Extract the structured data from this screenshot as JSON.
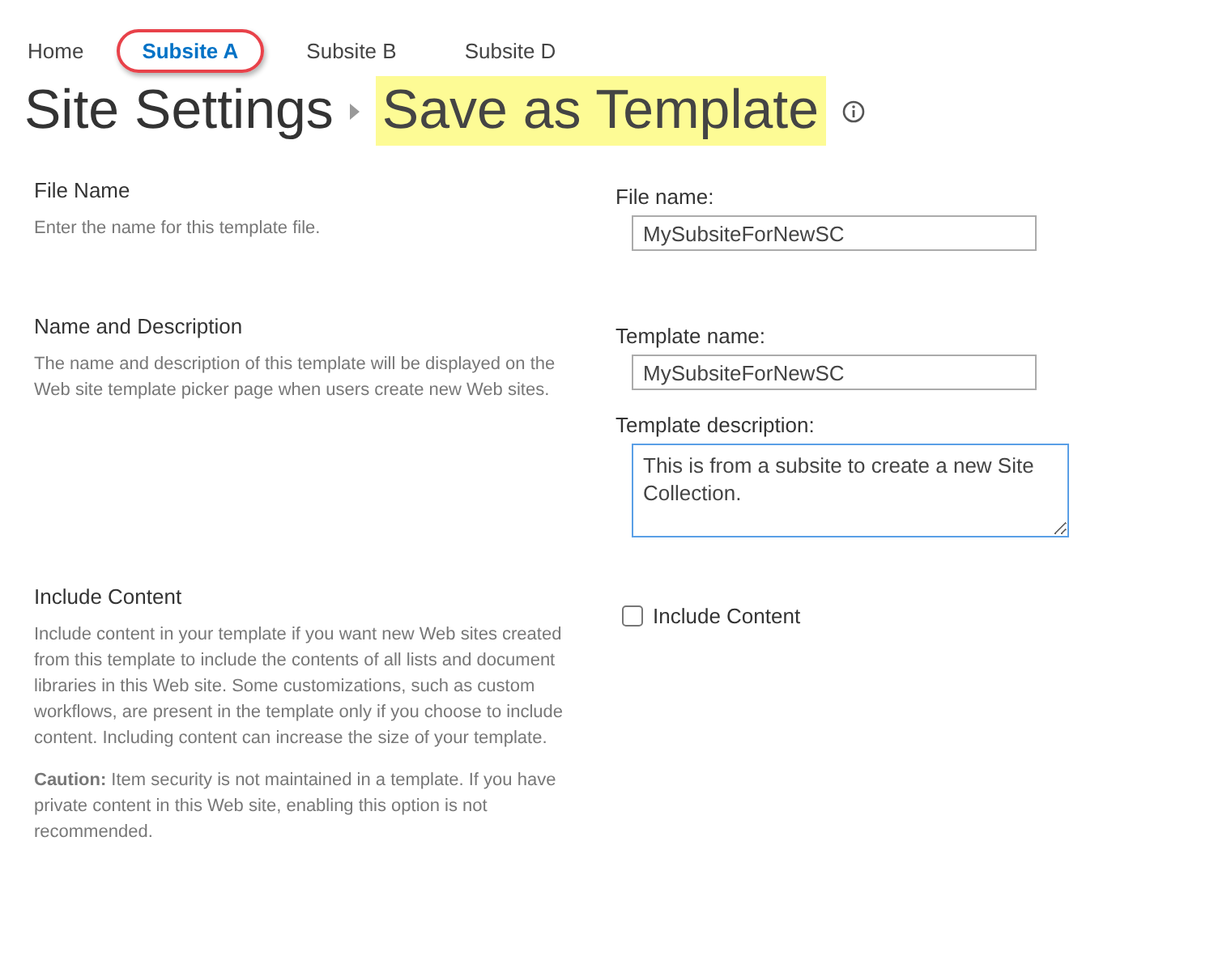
{
  "breadcrumb_nav": [
    {
      "label": "Home",
      "selected": false,
      "circled": false
    },
    {
      "label": "Subsite A",
      "selected": true,
      "circled": true
    },
    {
      "label": "Subsite B",
      "selected": false,
      "circled": false
    },
    {
      "label": "Subsite D",
      "selected": false,
      "circled": false
    }
  ],
  "page_title": {
    "parent": "Site Settings",
    "current": "Save as Template",
    "highlighted": true
  },
  "sections": [
    {
      "heading": "File Name",
      "paragraphs": [
        "Enter the name for this template file."
      ],
      "fields": [
        {
          "kind": "text",
          "label": "File name:",
          "value": "MySubsiteForNewSC",
          "focused": false
        }
      ]
    },
    {
      "heading": "Name and Description",
      "paragraphs": [
        "The name and description of this template will be displayed on the Web site template picker page when users create new Web sites."
      ],
      "fields": [
        {
          "kind": "text",
          "label": "Template name:",
          "value": "MySubsiteForNewSC",
          "focused": false
        },
        {
          "kind": "textarea",
          "label": "Template description:",
          "value": "This is from a subsite to create a new Site Collection.",
          "focused": true
        }
      ]
    },
    {
      "heading": "Include Content",
      "paragraphs": [
        "Include content in your template if you want new Web sites created from this template to include the contents of all lists and document libraries in this Web site. Some customizations, such as custom workflows, are present in the template only if you choose to include content. Including content can increase the size of your template.",
        "**Caution:** Item security is not maintained in a template. If you have private content in this Web site, enabling this option is not recommended."
      ],
      "fields": [
        {
          "kind": "checkbox",
          "label": "Include Content",
          "checked": false
        }
      ]
    }
  ]
}
